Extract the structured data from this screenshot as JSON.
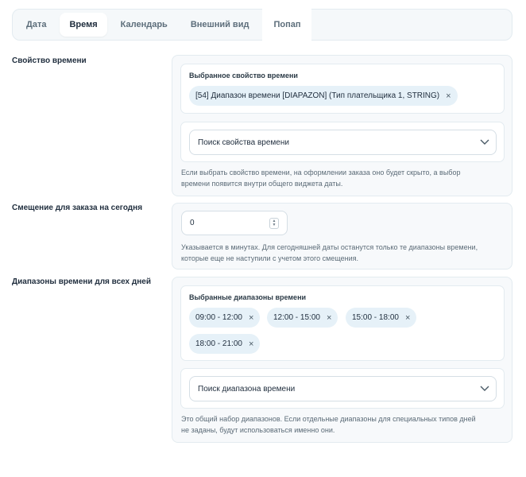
{
  "tabs": [
    {
      "label": "Дата"
    },
    {
      "label": "Время"
    },
    {
      "label": "Календарь"
    },
    {
      "label": "Внешний вид"
    },
    {
      "label": "Попап"
    }
  ],
  "active_tab": "Время",
  "time_property": {
    "section_label": "Свойство времени",
    "selected_title": "Выбранное свойство времени",
    "selected_chip": "[54] Диапазон времени [DIAPAZON] (Тип плательщика 1, STRING)",
    "search_placeholder": "Поиск свойства времени",
    "help_line1": "Если выбрать свойство времени, на оформлении заказа оно будет скрыто, а выбор",
    "help_line2": "времени появится внутри общего виджета даты."
  },
  "offset": {
    "section_label": "Смещение для заказа на сегодня",
    "value": "0",
    "help_line1": "Указывается в минутах. Для сегодняшней даты останутся только те диапазоны времени,",
    "help_line2": "которые еще не наступили с учетом этого смещения."
  },
  "ranges": {
    "section_label": "Диапазоны времени для всех дней",
    "selected_title": "Выбранные диапазоны времени",
    "chips": [
      "09:00 - 12:00",
      "12:00 - 15:00",
      "15:00 - 18:00",
      "18:00 - 21:00"
    ],
    "search_placeholder": "Поиск диапазона времени",
    "help_line1": "Это общий набор диапазонов. Если отдельные диапазоны для специальных типов дней",
    "help_line2": "не заданы, будут использоваться именно они."
  },
  "icons": {
    "chip_remove": "×",
    "dropdown": "chevron-down-icon"
  },
  "colors": {
    "chip_bg": "#e6f1f8",
    "panel_bg": "#f7f9fb",
    "border": "#e3ebf0"
  }
}
